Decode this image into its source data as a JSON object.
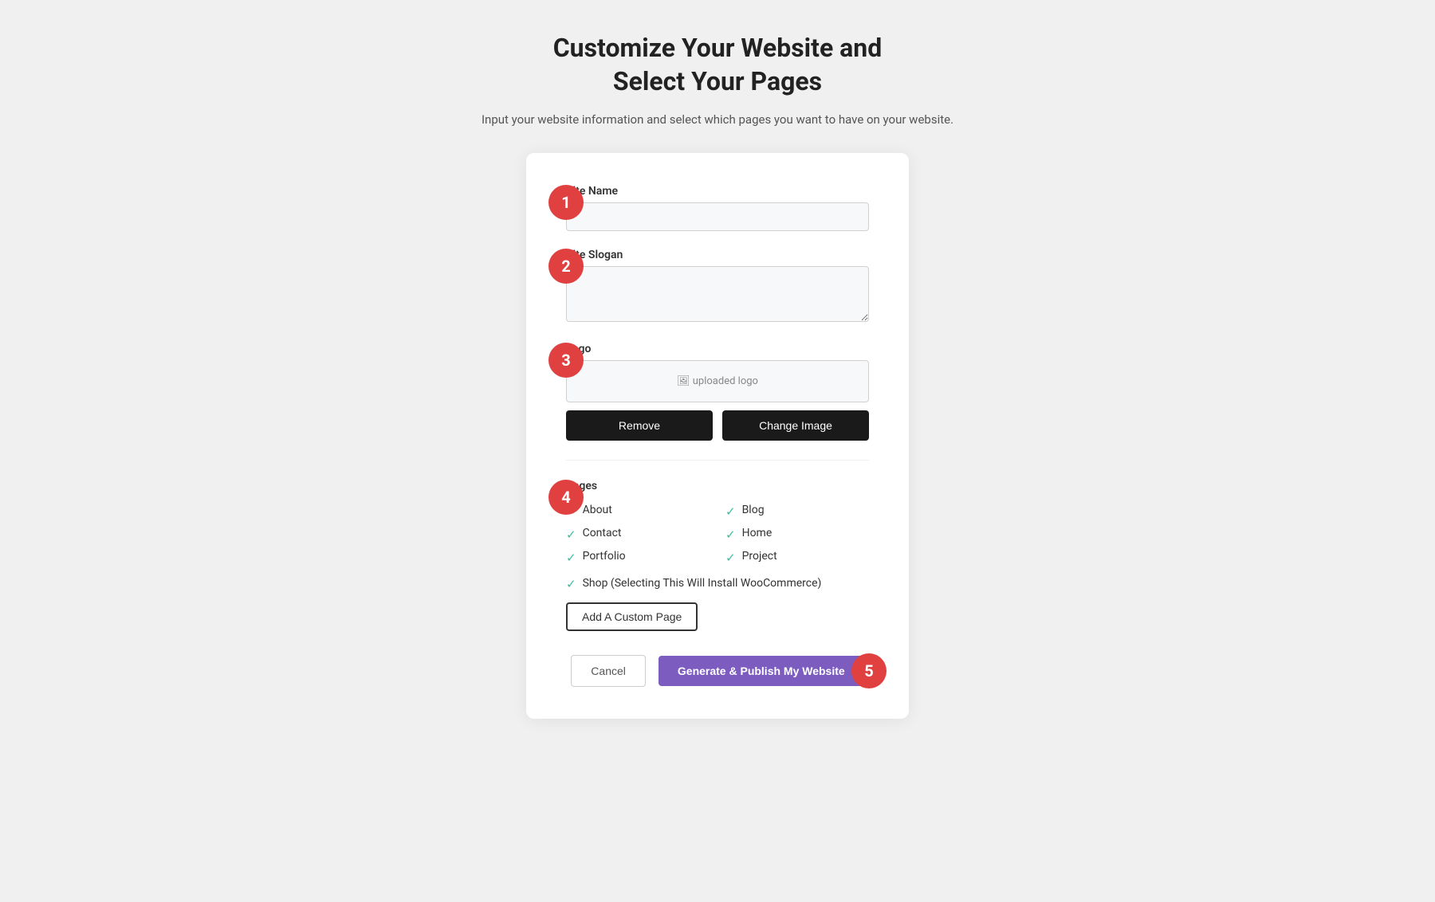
{
  "header": {
    "title": "Customize Your Website and\nSelect Your Pages",
    "subtitle": "Input your website information and select which pages you want to have on your website."
  },
  "steps": {
    "badge1": "1",
    "badge2": "2",
    "badge3": "3",
    "badge4": "4",
    "badge5": "5"
  },
  "fields": {
    "site_name_label": "Site Name",
    "site_name_placeholder": "",
    "site_slogan_label": "Site Slogan",
    "site_slogan_placeholder": "",
    "logo_label": "Logo",
    "logo_preview_text": "uploaded logo"
  },
  "buttons": {
    "remove": "Remove",
    "change_image": "Change Image",
    "add_custom_page": "Add A Custom Page",
    "cancel": "Cancel",
    "publish": "Generate & Publish My Website"
  },
  "pages": {
    "label": "Pages",
    "items": [
      {
        "name": "About",
        "checked": true
      },
      {
        "name": "Blog",
        "checked": true
      },
      {
        "name": "Contact",
        "checked": true
      },
      {
        "name": "Home",
        "checked": true
      },
      {
        "name": "Portfolio",
        "checked": true
      },
      {
        "name": "Project",
        "checked": true
      }
    ],
    "shop": {
      "name": "Shop (Selecting This Will Install WooCommerce)",
      "checked": true
    }
  }
}
